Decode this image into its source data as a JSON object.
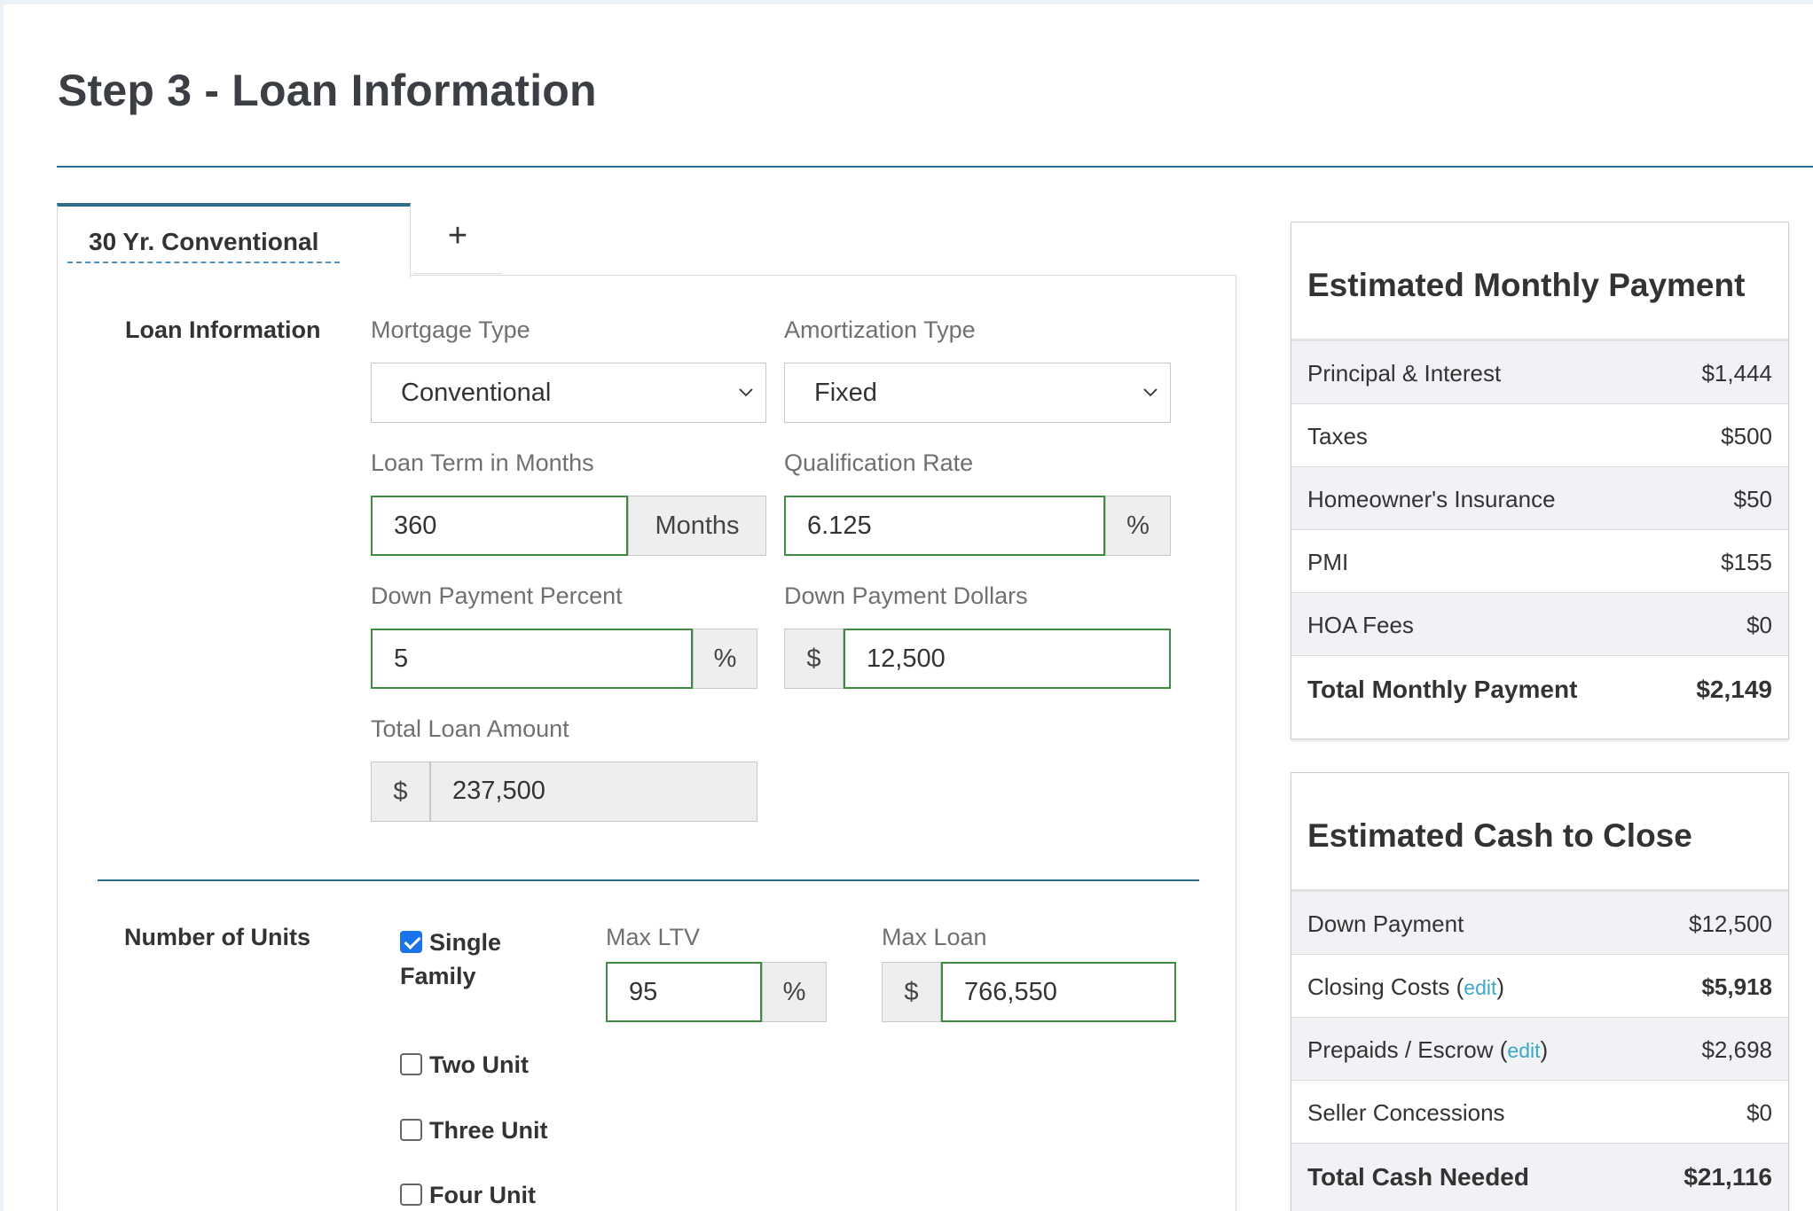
{
  "page": {
    "title": "Step 3 - Loan Information"
  },
  "tabs": {
    "active_label": "30 Yr. Conventional",
    "add_label": "+"
  },
  "loan_info": {
    "section_label": "Loan Information",
    "mortgage_type": {
      "label": "Mortgage Type",
      "value": "Conventional"
    },
    "amortization_type": {
      "label": "Amortization Type",
      "value": "Fixed"
    },
    "loan_term": {
      "label": "Loan Term in Months",
      "value": "360",
      "addon": "Months"
    },
    "qualification_rate": {
      "label": "Qualification Rate",
      "value": "6.125",
      "addon": "%"
    },
    "down_payment_percent": {
      "label": "Down Payment Percent",
      "value": "5",
      "addon": "%"
    },
    "down_payment_dollars": {
      "label": "Down Payment Dollars",
      "value": "12,500",
      "addon": "$"
    },
    "total_loan_amount": {
      "label": "Total Loan Amount",
      "value": "237,500",
      "addon": "$"
    }
  },
  "units": {
    "section_label": "Number of Units",
    "options": [
      {
        "label_line1": "Single",
        "label_line2": "Family",
        "checked": true
      },
      {
        "label": "Two Unit",
        "checked": false
      },
      {
        "label": "Three Unit",
        "checked": false
      },
      {
        "label": "Four Unit",
        "checked": false
      }
    ],
    "max_ltv": {
      "label": "Max LTV",
      "value": "95",
      "addon": "%"
    },
    "max_loan": {
      "label": "Max Loan",
      "value": "766,550",
      "addon": "$"
    }
  },
  "monthly_payment": {
    "title": "Estimated Monthly Payment",
    "rows": [
      {
        "label": "Principal & Interest",
        "value": "$1,444"
      },
      {
        "label": "Taxes",
        "value": "$500"
      },
      {
        "label": "Homeowner's Insurance",
        "value": "$50"
      },
      {
        "label": "PMI",
        "value": "$155"
      },
      {
        "label": "HOA Fees",
        "value": "$0"
      }
    ],
    "total": {
      "label": "Total Monthly Payment",
      "value": "$2,149"
    }
  },
  "cash_to_close": {
    "title": "Estimated Cash to Close",
    "rows": [
      {
        "label": "Down Payment",
        "value": "$12,500"
      },
      {
        "label": "Closing Costs",
        "edit": "edit",
        "value": "$5,918"
      },
      {
        "label": "Prepaids / Escrow",
        "edit": "edit",
        "value": "$2,698"
      },
      {
        "label": "Seller Concessions",
        "value": "$0"
      }
    ],
    "total": {
      "label": "Total Cash Needed",
      "value": "$21,116"
    }
  },
  "colors": {
    "accent": "#2f6b8a",
    "valid_border": "#3e8a3e",
    "edit_link": "#3aa9c9",
    "checkbox": "#1a73e8"
  }
}
